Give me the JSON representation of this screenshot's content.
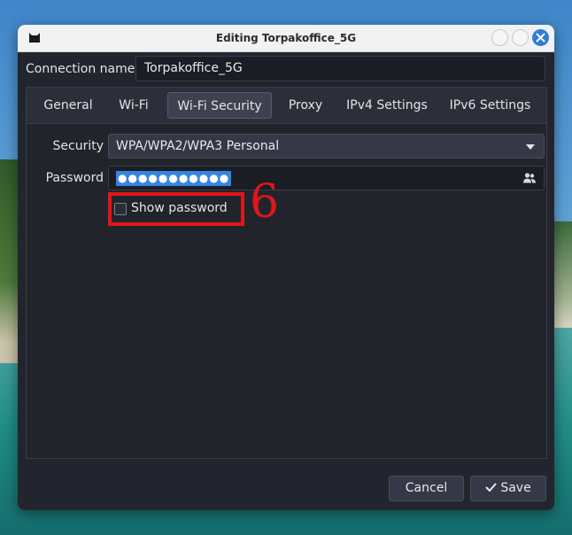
{
  "window": {
    "title": "Editing Torpakoffice_5G"
  },
  "connection": {
    "label": "Connection name",
    "value": "Torpakoffice_5G"
  },
  "tabs": [
    {
      "label": "General"
    },
    {
      "label": "Wi-Fi"
    },
    {
      "label": "Wi-Fi Security",
      "active": true
    },
    {
      "label": "Proxy"
    },
    {
      "label": "IPv4 Settings"
    },
    {
      "label": "IPv6 Settings"
    }
  ],
  "security": {
    "label": "Security",
    "selected": "WPA/WPA2/WPA3 Personal"
  },
  "password": {
    "label": "Password",
    "masked_value": "●●●●●●●●●●●",
    "icon": "users-icon"
  },
  "show_password": {
    "label": "Show password",
    "checked": false
  },
  "annotation": {
    "number": "6",
    "color": "#e0161b"
  },
  "buttons": {
    "cancel": "Cancel",
    "save": "Save"
  },
  "colors": {
    "accent": "#3584e4",
    "close_button": "#2d7cd6"
  }
}
